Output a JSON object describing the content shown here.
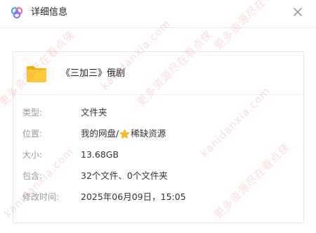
{
  "dialog": {
    "title": "详细信息",
    "close_label": "×"
  },
  "file": {
    "name": "《三加三》俄剧",
    "icon": "folder-icon"
  },
  "details": [
    {
      "label": "类型:",
      "value": "文件夹"
    },
    {
      "label": "位置:",
      "value_before": "我的网盘/",
      "value_after": "稀缺资源",
      "value_icon": "star-icon"
    },
    {
      "label": "大小:",
      "value": "13.68GB"
    },
    {
      "label": "包含:",
      "value": "32个文件、0个文件夹"
    },
    {
      "label": "修改时间:",
      "value": "2025年06月09日，15:05"
    }
  ],
  "watermark": {
    "text_a": "kanidanxia.com",
    "text_b": "更多资源尽在看点侠",
    "color": "#ee5a5a"
  },
  "colors": {
    "folder": "#ffc93c",
    "star": "#ffc022",
    "label": "#9a9a9a"
  }
}
